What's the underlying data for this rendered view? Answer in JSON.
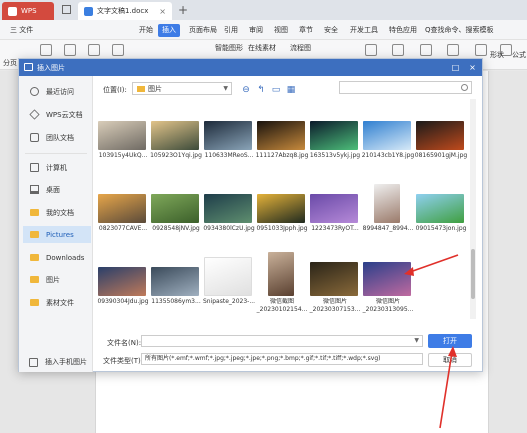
{
  "app": {
    "brand_tab": "WPS",
    "doc_tab": "文字文稿1.docx"
  },
  "menu": {
    "file": "三 文件",
    "items": [
      "开始",
      "插入",
      "页面布局",
      "引用",
      "审阅",
      "视图",
      "章节",
      "安全",
      "开发工具",
      "特色应用"
    ],
    "active": "插入",
    "search": "Q查找命令、搜索模板"
  },
  "ribbon": {
    "labels": [
      "智能图形",
      "在线素材",
      "流程图"
    ],
    "side_left": "分页",
    "side_right": [
      "形状",
      "公式"
    ]
  },
  "dialog": {
    "title": "插入图片",
    "sidebar": {
      "items": [
        {
          "label": "最近访问",
          "icon": "clock-icon"
        },
        {
          "label": "WPS云文档",
          "icon": "cloud-cube-icon"
        },
        {
          "label": "团队文档",
          "icon": "team-icon"
        },
        {
          "label": "计算机",
          "icon": "computer-icon"
        },
        {
          "label": "桌面",
          "icon": "desktop-icon"
        },
        {
          "label": "我的文档",
          "icon": "folder-icon"
        },
        {
          "label": "Pictures",
          "icon": "folder-icon"
        },
        {
          "label": "Downloads",
          "icon": "folder-icon"
        },
        {
          "label": "图片",
          "icon": "folder-icon"
        },
        {
          "label": "素材文件",
          "icon": "folder-icon"
        }
      ],
      "active": "Pictures",
      "bottom": "插入手机图片"
    },
    "location": {
      "label": "位置(I):",
      "value": "图片"
    },
    "files": [
      {
        "name": "103915y4UkQ...",
        "colors": [
          "#d9cdb9",
          "#6f6a63"
        ]
      },
      {
        "name": "105923O1Yqi.jpg",
        "colors": [
          "#e2c48a",
          "#3c4b3a"
        ]
      },
      {
        "name": "110633MReoS...",
        "colors": [
          "#1d2a3a",
          "#8aa4b8"
        ]
      },
      {
        "name": "111127Abzq8.jpg",
        "colors": [
          "#18120d",
          "#c78a3c"
        ]
      },
      {
        "name": "163513v5ykj.jpg",
        "colors": [
          "#0b1a2b",
          "#4dbf7a"
        ]
      },
      {
        "name": "210143cb1Y8.jpg",
        "colors": [
          "#2f7fd0",
          "#d6e9f7"
        ]
      },
      {
        "name": "08165901gjM.jpg",
        "colors": [
          "#1a1a1a",
          "#c04a1c"
        ]
      },
      {
        "name": "0823077CAVE...",
        "colors": [
          "#e7a64a",
          "#5a4a3a"
        ]
      },
      {
        "name": "0928548jNV.jpg",
        "colors": [
          "#7fa85a",
          "#3b5f2a"
        ]
      },
      {
        "name": "0934380lCzU.jpg",
        "colors": [
          "#1e3d4a",
          "#5f8f6f"
        ]
      },
      {
        "name": "0951033Jpph.jpg",
        "colors": [
          "#e4b23a",
          "#1f2a1f"
        ]
      },
      {
        "name": "1223473RyOT...",
        "colors": [
          "#6a4aa8",
          "#b68ad8"
        ]
      },
      {
        "name": "8994847_8994...",
        "colors": [
          "#efefef",
          "#9a7a6a"
        ]
      },
      {
        "name": "09015473jon.jpg",
        "colors": [
          "#8fd0f0",
          "#3f9f3f"
        ]
      },
      {
        "name": "09390304Jdu.jpg",
        "colors": [
          "#2a3f6a",
          "#c07a5a"
        ]
      },
      {
        "name": "11355086ym3...",
        "colors": [
          "#3a4a5a",
          "#a0b0c0"
        ]
      },
      {
        "name": "Snipaste_2023-...",
        "colors": [
          "#ffffff",
          "#e0e0e0"
        ]
      },
      {
        "name": "微信截图\n_20230102154...",
        "colors": [
          "#c9b19a",
          "#5a4030"
        ]
      },
      {
        "name": "微信图片\n_20230307153...",
        "colors": [
          "#2a2418",
          "#8a6a3a"
        ]
      },
      {
        "name": "微信图片\n_20230313095...",
        "colors": [
          "#2a3f8a",
          "#c06aa0"
        ]
      }
    ],
    "filename_label": "文件名(N):",
    "filename_value": "",
    "filetype_label": "文件类型(T):",
    "filetype_value": "所有图片(*.emf;*.wmf;*.jpg;*.jpeg;*.jpe;*.png;*.bmp;*.gif;*.tif;*.tiff;*.wdp;*.svg)",
    "open_button": "打开",
    "cancel_button": "取消"
  },
  "colors": {
    "accent": "#3e7ce6",
    "title_bar": "#3d6fbf",
    "annotation": "#e0302a"
  }
}
